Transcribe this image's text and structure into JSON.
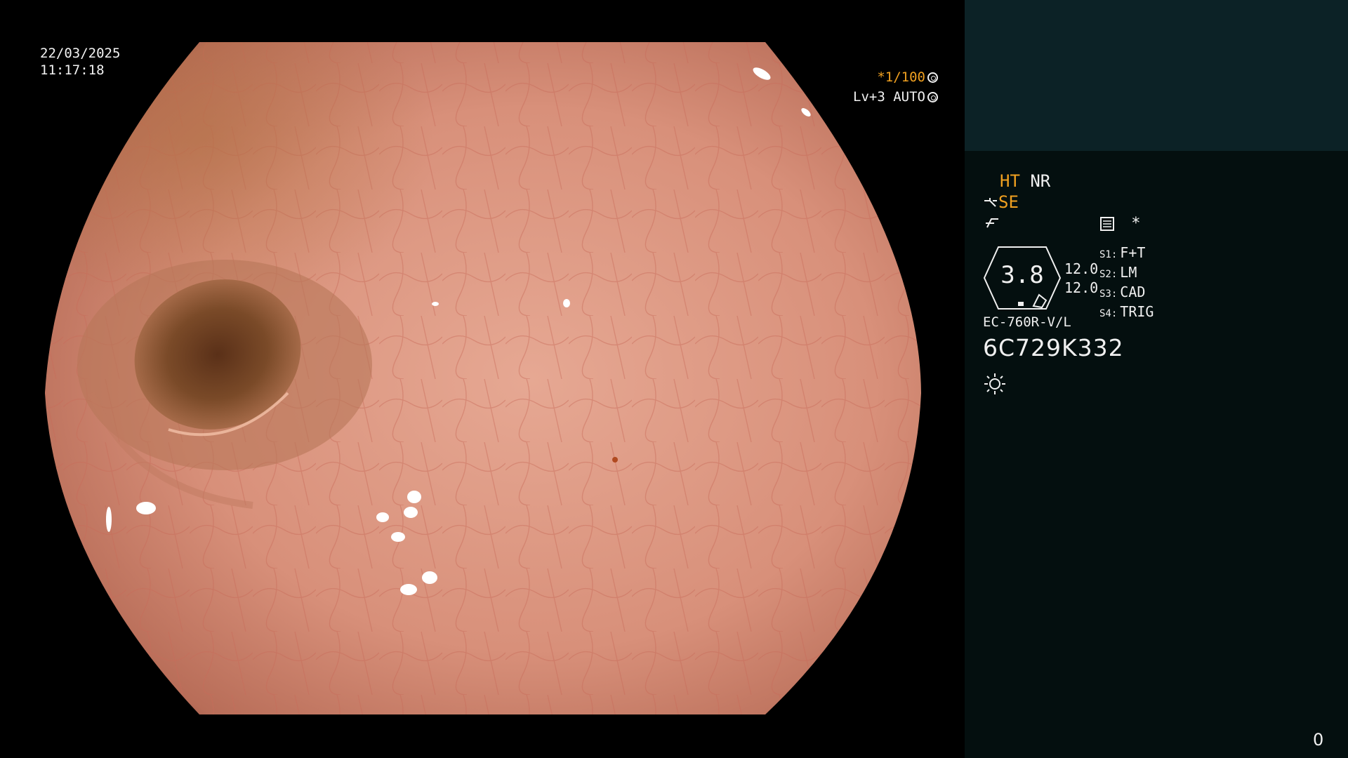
{
  "overlay": {
    "date": "22/03/2025",
    "time": "11:17:18",
    "shutter_prefix": "*1/100",
    "level_text": "Lv+3 AUTO",
    "accent_color": "#f0a020"
  },
  "panel": {
    "ht_label": "HT",
    "nr_label": "NR",
    "se_label": "SE",
    "star_label": "*",
    "badge_value": "3.8",
    "side_values": [
      "12.0",
      "12.0"
    ],
    "switches": [
      {
        "key": "S1:",
        "value": "F+T"
      },
      {
        "key": "S2:",
        "value": "LM"
      },
      {
        "key": "S3:",
        "value": "CAD"
      },
      {
        "key": "S4:",
        "value": "TRIG"
      }
    ],
    "scope_model": "EC-760R-V/L",
    "scope_serial": "6C729K332",
    "page_number": "0",
    "top_block_color": "#0c2226",
    "bg_color": "#040f0f"
  },
  "icons": [
    "aperture-icon",
    "iris-icon",
    "scope-hand-icon",
    "modulation-icon",
    "menu-list-icon",
    "light-source-icon"
  ]
}
